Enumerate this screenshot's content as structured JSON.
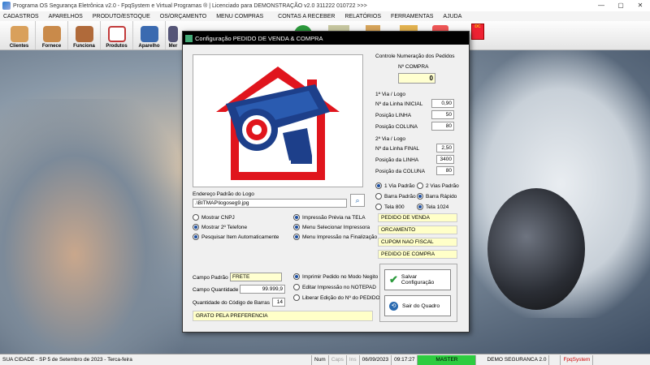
{
  "window": {
    "title": "Programa OS Segurança Eletrônica v2.0 - FpqSystem e Virtual Programas ® | Licenciado para  DEMONSTRAÇÃO v2.0 311222 010722 >>>",
    "min": "—",
    "max": "▢",
    "close": "✕"
  },
  "menu": [
    "CADASTROS",
    "APARELHOS",
    "PRODUTO/ESTOQUE",
    "OS/ORÇAMENTO",
    "MENU COMPRAS",
    "CONTAS A RECEBER",
    "RELATÓRIOS",
    "FERRAMENTAS",
    "AJUDA"
  ],
  "toolbar": [
    {
      "label": "Clientes",
      "color": "#d9a05b"
    },
    {
      "label": "Fornece",
      "color": "#c98a4a"
    },
    {
      "label": "Funciona",
      "color": "#b06a3a"
    },
    {
      "label": "Produtos",
      "color": "#c23a3a"
    },
    {
      "label": "Aparelho",
      "color": "#3a6ab0"
    },
    {
      "label": "Mer",
      "color": "#557"
    }
  ],
  "dialog": {
    "title": "Configuração PEDIDO DE VENDA & COMPRA",
    "logo_path_label": "Endereço Padrão do Logo",
    "logo_path": ".\\BITMAP\\logoseg9.jpg",
    "numbering": {
      "title": "Controle Numeração dos Pedidos",
      "label": "Nº COMPRA",
      "value": "0"
    },
    "via1": {
      "title": "1ª Via / Logo",
      "rows": [
        {
          "label": "Nº da Linha INICIAL",
          "value": "0,90"
        },
        {
          "label": "Posição LINHA",
          "value": "50"
        },
        {
          "label": "Posição COLUNA",
          "value": "80"
        }
      ]
    },
    "via2": {
      "title": "2ª Via / Logo",
      "rows": [
        {
          "label": "Nº da Linha FINAL",
          "value": "2,50"
        },
        {
          "label": "Posição da LINHA",
          "value": "3400"
        },
        {
          "label": "Posição da COLUNA",
          "value": "80"
        }
      ]
    },
    "opts_right": [
      {
        "label": "1 Via Padrão",
        "checked": true
      },
      {
        "label": "2 Vias Padrão",
        "checked": false
      },
      {
        "label": "Barra Padrão",
        "checked": false
      },
      {
        "label": "Barra Rápido",
        "checked": true
      },
      {
        "label": "Tela 800",
        "checked": false
      },
      {
        "label": "Tela 1024",
        "checked": true
      }
    ],
    "doc_labels": [
      "PEDIDO DE VENDA",
      "ORCAMENTO",
      "CUPOM NAO FISCAL",
      "PEDIDO DE COMPRA"
    ],
    "opts_left": [
      {
        "label": "Mostrar CNPJ",
        "checked": false
      },
      {
        "label": "Mostrar 2º Telefone",
        "checked": true
      },
      {
        "label": "Pesquisar Item Automaticamente",
        "checked": true
      }
    ],
    "opts_mid": [
      {
        "label": "Impressão Prévia na TELA",
        "checked": true
      },
      {
        "label": "Menu Selecionar Impressora",
        "checked": true
      },
      {
        "label": "Menu Impressão na Finalização",
        "checked": true
      }
    ],
    "campo_padrao": {
      "label": "Campo Padrão",
      "value": "FRETE"
    },
    "campo_qtd": {
      "label": "Campo Quantidade",
      "value": "99.999,9"
    },
    "qtd_barras": {
      "label": "Quantidade do Código de Barras",
      "value": "14"
    },
    "footer_text": "GRATO PELA PREFERENCIA",
    "opts_bottom": [
      {
        "label": "Imprimir Pedido no Modo Negito",
        "checked": true
      },
      {
        "label": "Editar Impressão no NOTEPAD",
        "checked": false
      },
      {
        "label": "Liberar Edição do Nº do PEDIDO",
        "checked": false
      }
    ],
    "save_label": "Salvar Configuração",
    "exit_label": "Sair do Quadro"
  },
  "status": {
    "city": "SUA CIDADE - SP  5 de Setembro de 2023 - Terca-feira",
    "num": "Num",
    "caps": "Caps",
    "ins": "Ins",
    "date": "06/09/2023",
    "time": "09:17:27",
    "master": "MASTER",
    "company": "DEMO SEGURANCA 2.0",
    "brand": "FpqSystem"
  }
}
